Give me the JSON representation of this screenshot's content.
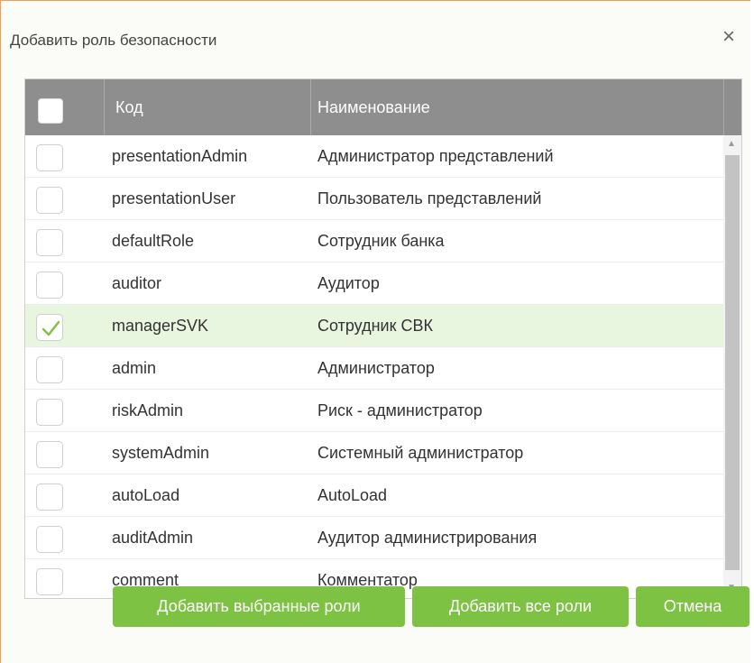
{
  "dialog": {
    "title": "Добавить роль безопасности",
    "close_glyph": "×"
  },
  "grid": {
    "columns": [
      "Код",
      "Наименование"
    ],
    "rows": [
      {
        "code": "presentationAdmin",
        "name": "Администратор представлений",
        "checked": false
      },
      {
        "code": "presentationUser",
        "name": "Пользователь представлений",
        "checked": false
      },
      {
        "code": "defaultRole",
        "name": "Сотрудник банка",
        "checked": false
      },
      {
        "code": "auditor",
        "name": "Аудитор",
        "checked": false
      },
      {
        "code": "managerSVK",
        "name": "Сотрудник СВК",
        "checked": true
      },
      {
        "code": "admin",
        "name": "Администратор",
        "checked": false
      },
      {
        "code": "riskAdmin",
        "name": "Риск - администратор",
        "checked": false
      },
      {
        "code": "systemAdmin",
        "name": "Системный администратор",
        "checked": false
      },
      {
        "code": "autoLoad",
        "name": "AutoLoad",
        "checked": false
      },
      {
        "code": "auditAdmin",
        "name": "Аудитор администрирования",
        "checked": false
      },
      {
        "code": "comment",
        "name": "Комментатор",
        "checked": false
      }
    ]
  },
  "buttons": {
    "add_selected": "Добавить выбранные роли",
    "add_all": "Добавить все роли",
    "cancel": "Отмена"
  },
  "colors": {
    "accent": "#7dc242",
    "header_bg": "#8e8e8e",
    "selected_row": "#e8f5df",
    "dialog_border": "#f0a050"
  }
}
